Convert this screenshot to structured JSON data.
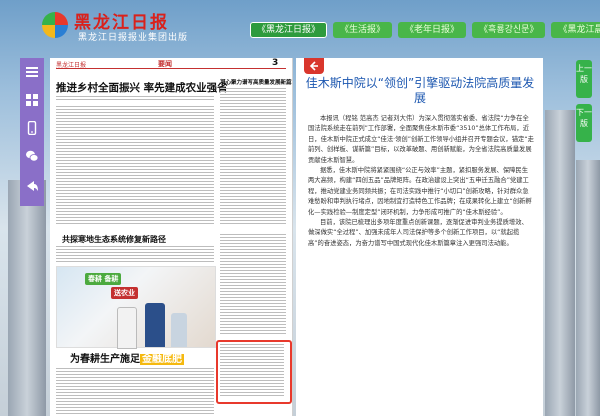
{
  "header": {
    "brand_name": "黑龙江日报",
    "brand_subtitle": "黑龙江日报报业集团出版",
    "paper_tabs": [
      {
        "label": "《黑龙江日报》",
        "active": true
      },
      {
        "label": "《生活报》",
        "active": false
      },
      {
        "label": "《老年日报》",
        "active": false
      },
      {
        "label": "《흑룡강신문》",
        "active": false
      },
      {
        "label": "《黑龙江晨报》",
        "active": false
      }
    ]
  },
  "sidebar": {
    "icons": [
      "list-icon",
      "grid-icon",
      "mobile-icon",
      "wechat-icon",
      "share-icon"
    ],
    "accent_color": "#8a6fc8"
  },
  "newspaper": {
    "masthead": "黑龙江日报",
    "section": "要闻",
    "page_number": "3",
    "headline_1": "推进乡村全面振兴 率先建成农业强省",
    "headline_2": "凝心聚力谱写高质量发展新篇章",
    "headline_3": "共探寒地生态系统修复新路径",
    "headline_4": "为春耕生产施足",
    "headline_4_highlight": "金融底肥",
    "photo_caption": "春耕 备耕",
    "photo_tag": "送农业"
  },
  "article": {
    "title": "佳木斯中院以“领创”引擎驱动法院高质量发展",
    "paragraphs": [
      "本报讯（程铭 范高杰 记者刘大伟）为深入贯彻落实省委、省法院“力争在全国法院系统走在前列”工作部署，全面聚焦佳木斯市委“3510”总体工作布局，近日，佳木斯中院正式成立“佳法·领创”创新工作领导小组并召开专题会议，锚定“走前列、创样板、谋新篇”目标，以改革破题、用创新赋能，为全省法院高质量发展贡献佳木斯智慧。",
      "据悉，佳木斯中院将紧紧围绕“公正与效率”主题，紧扣服务发展、保障民生两大高频，构建“四创五品”品牌矩阵。在政治建设上突出“五申迁五融合”党建工程，推动党建业务同频共振；在司法实践中推行“小切口”创新攻略，针对群众急难愁盼和审判执行堵点，因地制宜打造特色工作品牌；在成果转化上建立“创新孵化—实践检验—制度定型”闭环机制，力争形成可推广的“佳木斯经验”。",
      "目前，该院已梳理出多项年度重点创新课题，逐渐促进审判业务提质增效、做深做实“全过程”、加强未成年人司法保护等多个创新工作项目，以“就起揽高”的奋进姿态，为奋力谱写中国式现代化佳木斯篇章注入更强司法动能。"
    ]
  },
  "pager": {
    "prev_label": "上一版",
    "next_label": "下一版",
    "color": "#36b24a"
  }
}
